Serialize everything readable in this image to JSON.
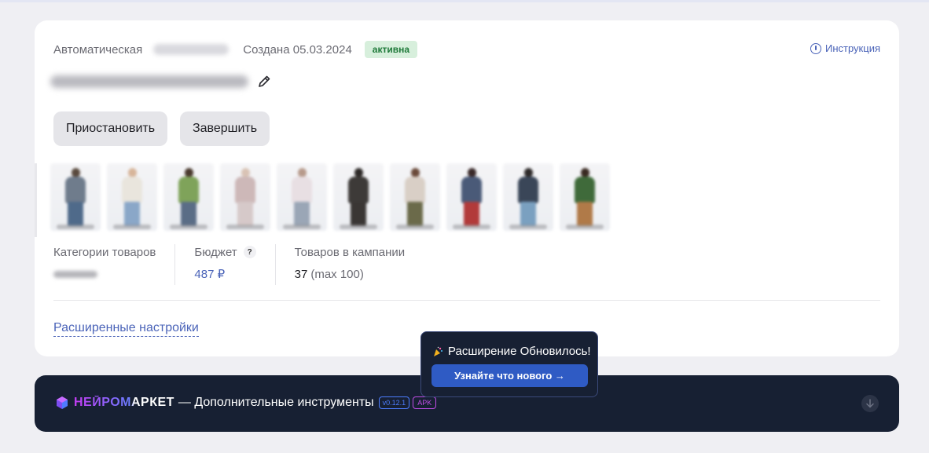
{
  "campaign": {
    "type": "Автоматическая",
    "created": "Создана 05.03.2024",
    "status": "активна",
    "instruction_link": "Инструкция",
    "actions": {
      "pause": "Приостановить",
      "finish": "Завершить"
    },
    "products_thumbnails": [
      {
        "name": "product-1"
      },
      {
        "name": "product-2"
      },
      {
        "name": "product-3"
      },
      {
        "name": "product-4"
      },
      {
        "name": "product-5"
      },
      {
        "name": "product-6"
      },
      {
        "name": "product-7"
      },
      {
        "name": "product-8"
      },
      {
        "name": "product-9"
      },
      {
        "name": "product-10"
      }
    ],
    "stats": {
      "categories_label": "Категории товаров",
      "budget_label": "Бюджет",
      "budget_help": "?",
      "budget_value": "487 ₽",
      "items_label": "Товаров в кампании",
      "items_count": "37",
      "items_max": "(max 100)"
    },
    "advanced_settings": "Расширенные настройки"
  },
  "extension_bar": {
    "logo": "НЕЙРОМАРКЕТ",
    "tagline": "— Дополнительные инструменты",
    "version": "v0.12.1",
    "apk": "APK"
  },
  "update_popup": {
    "title": "Расширение Обновилось!",
    "button": "Узнайте что нового →"
  },
  "colors": {
    "accent": "#4a63b8",
    "status_bg": "#d7efdc",
    "status_text": "#1f7a3a",
    "bar_bg": "#172033",
    "popup_button": "#2f5bc4"
  }
}
